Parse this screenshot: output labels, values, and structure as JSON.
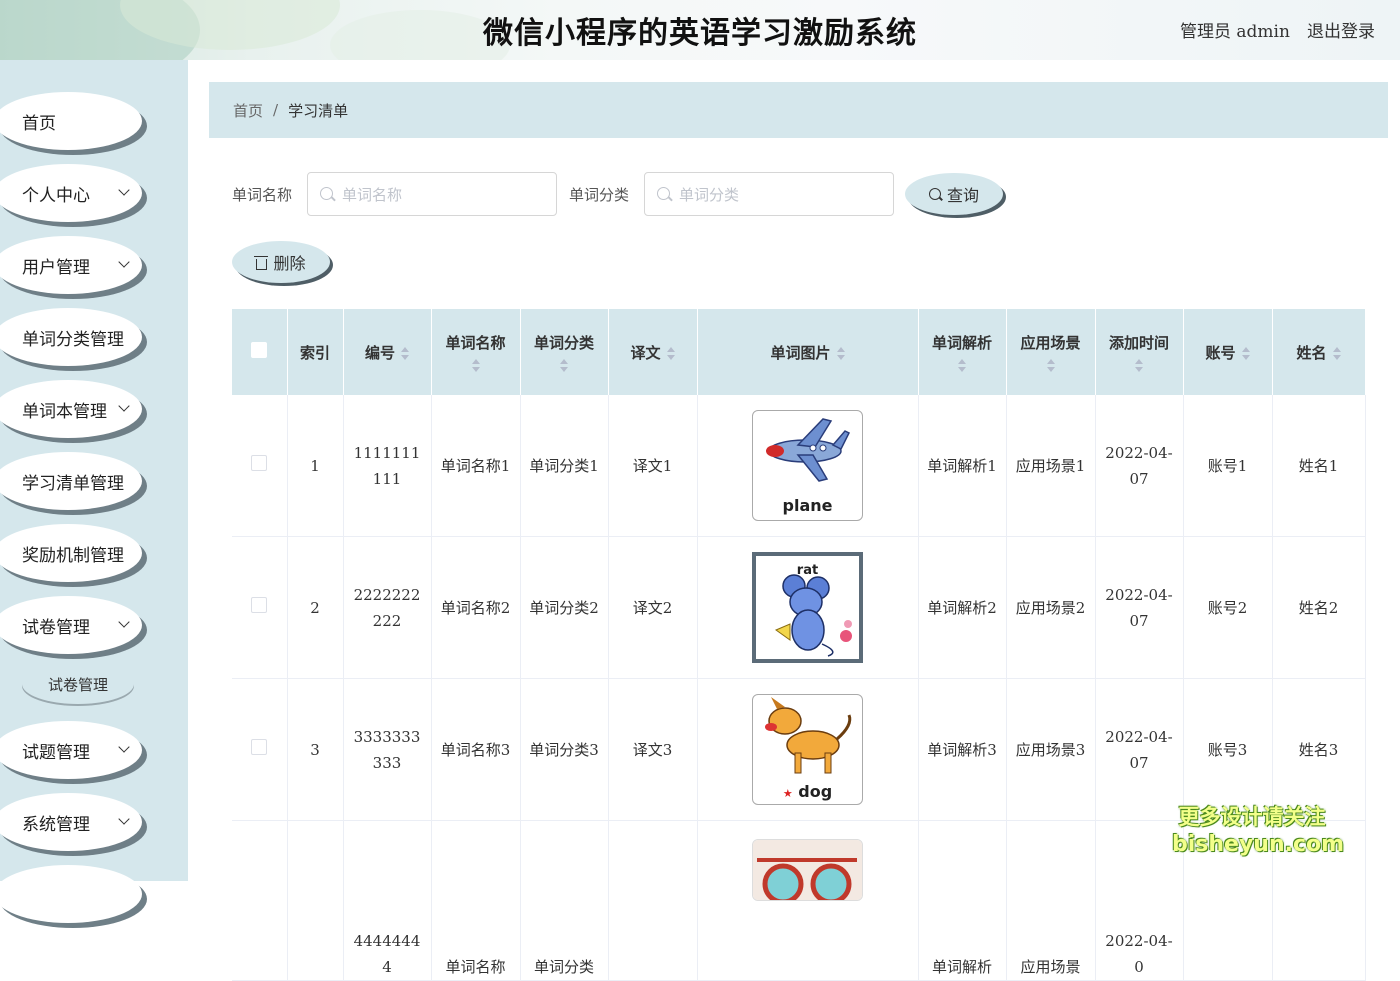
{
  "header": {
    "title": "微信小程序的英语学习激励系统",
    "admin": "管理员 admin",
    "logout": "退出登录"
  },
  "sidebar": {
    "items": [
      {
        "label": "首页"
      },
      {
        "label": "个人中心"
      },
      {
        "label": "用户管理"
      },
      {
        "label": "单词分类管理"
      },
      {
        "label": "单词本管理"
      },
      {
        "label": "学习清单管理"
      },
      {
        "label": "奖励机制管理"
      },
      {
        "label": "试卷管理"
      },
      {
        "label": "试题管理"
      },
      {
        "label": "系统管理"
      }
    ],
    "sub_item": "试卷管理"
  },
  "breadcrumb": {
    "home": "首页",
    "sep": "/",
    "current": "学习清单"
  },
  "search": {
    "word_name_label": "单词名称",
    "word_name_placeholder": "单词名称",
    "word_cat_label": "单词分类",
    "word_cat_placeholder": "单词分类",
    "query_button": "查询",
    "delete_button": "删除"
  },
  "table": {
    "headers": [
      "",
      "索引",
      "编号",
      "单词名称",
      "单词分类",
      "译文",
      "单词图片",
      "单词解析",
      "应用场景",
      "添加时间",
      "账号",
      "姓名"
    ],
    "rows": [
      {
        "index": "1",
        "code": "1111111111",
        "name": "单词名称1",
        "category": "单词分类1",
        "translation": "译文1",
        "image": "plane",
        "analysis": "单词解析1",
        "scene": "应用场景1",
        "time": "2022-04-07",
        "account": "账号1",
        "realname": "姓名1"
      },
      {
        "index": "2",
        "code": "2222222222",
        "name": "单词名称2",
        "category": "单词分类2",
        "translation": "译文2",
        "image": "rat",
        "analysis": "单词解析2",
        "scene": "应用场景2",
        "time": "2022-04-07",
        "account": "账号2",
        "realname": "姓名2"
      },
      {
        "index": "3",
        "code": "3333333333",
        "name": "单词名称3",
        "category": "单词分类3",
        "translation": "译文3",
        "image": "dog",
        "analysis": "单词解析3",
        "scene": "应用场景3",
        "time": "2022-04-07",
        "account": "账号3",
        "realname": "姓名3"
      },
      {
        "index": "",
        "code": "44444444",
        "name": "单词名称",
        "category": "单词分类",
        "translation": "",
        "image": "",
        "analysis": "单词解析",
        "scene": "应用场景",
        "time": "2022-04-0",
        "account": "",
        "realname": ""
      }
    ]
  },
  "watermark": {
    "line1": "更多设计请关注",
    "line2": "bisheyun.com"
  },
  "colors": {
    "accent": "#d5e7ec",
    "shadow": "#6f7f87"
  }
}
